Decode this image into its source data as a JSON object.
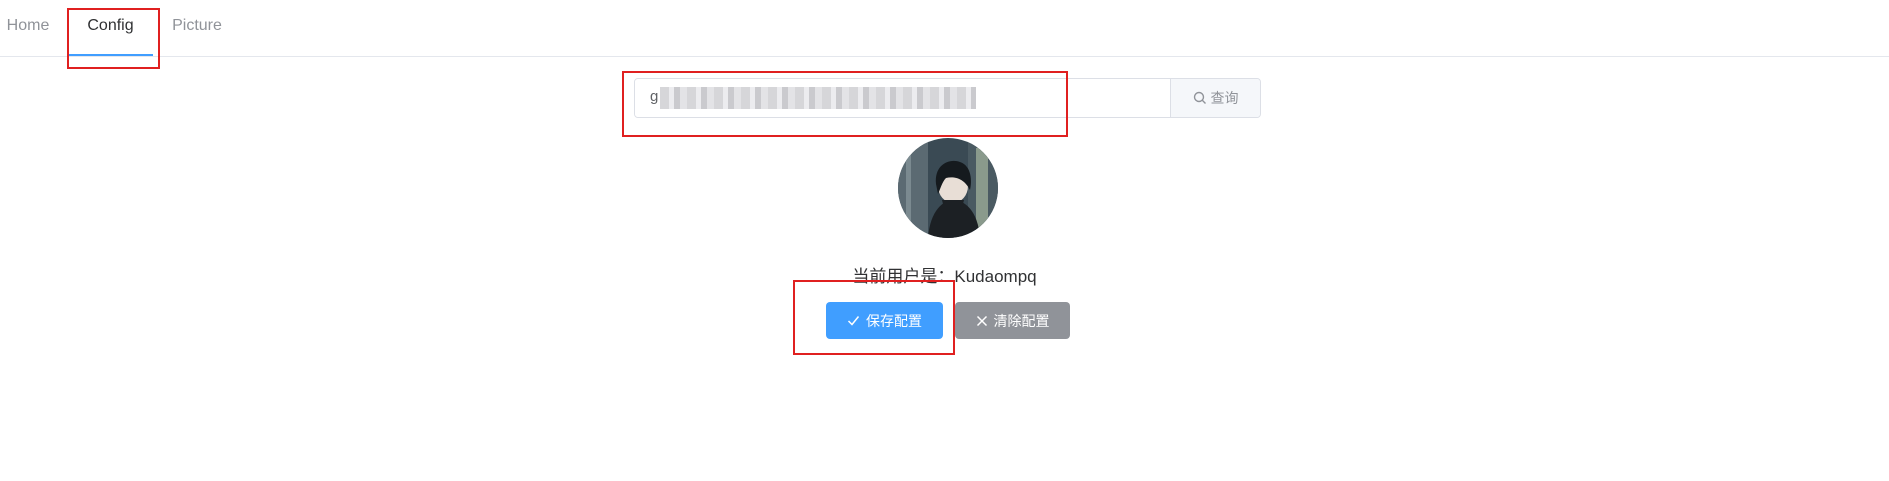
{
  "nav": {
    "tabs": [
      {
        "label": "Home"
      },
      {
        "label": "Config"
      },
      {
        "label": "Picture"
      }
    ],
    "active_tab": "Config"
  },
  "search": {
    "value_visible_prefix": "g",
    "button_label": "查询",
    "button_icon": "search-icon"
  },
  "user": {
    "label": "当前用户是：",
    "name": "Kudaompq"
  },
  "actions": {
    "save_label": "保存配置",
    "save_icon": "check-icon",
    "clear_label": "清除配置",
    "clear_icon": "close-icon"
  },
  "colors": {
    "primary": "#409eff",
    "info": "#909399",
    "highlight": "#e02020"
  }
}
